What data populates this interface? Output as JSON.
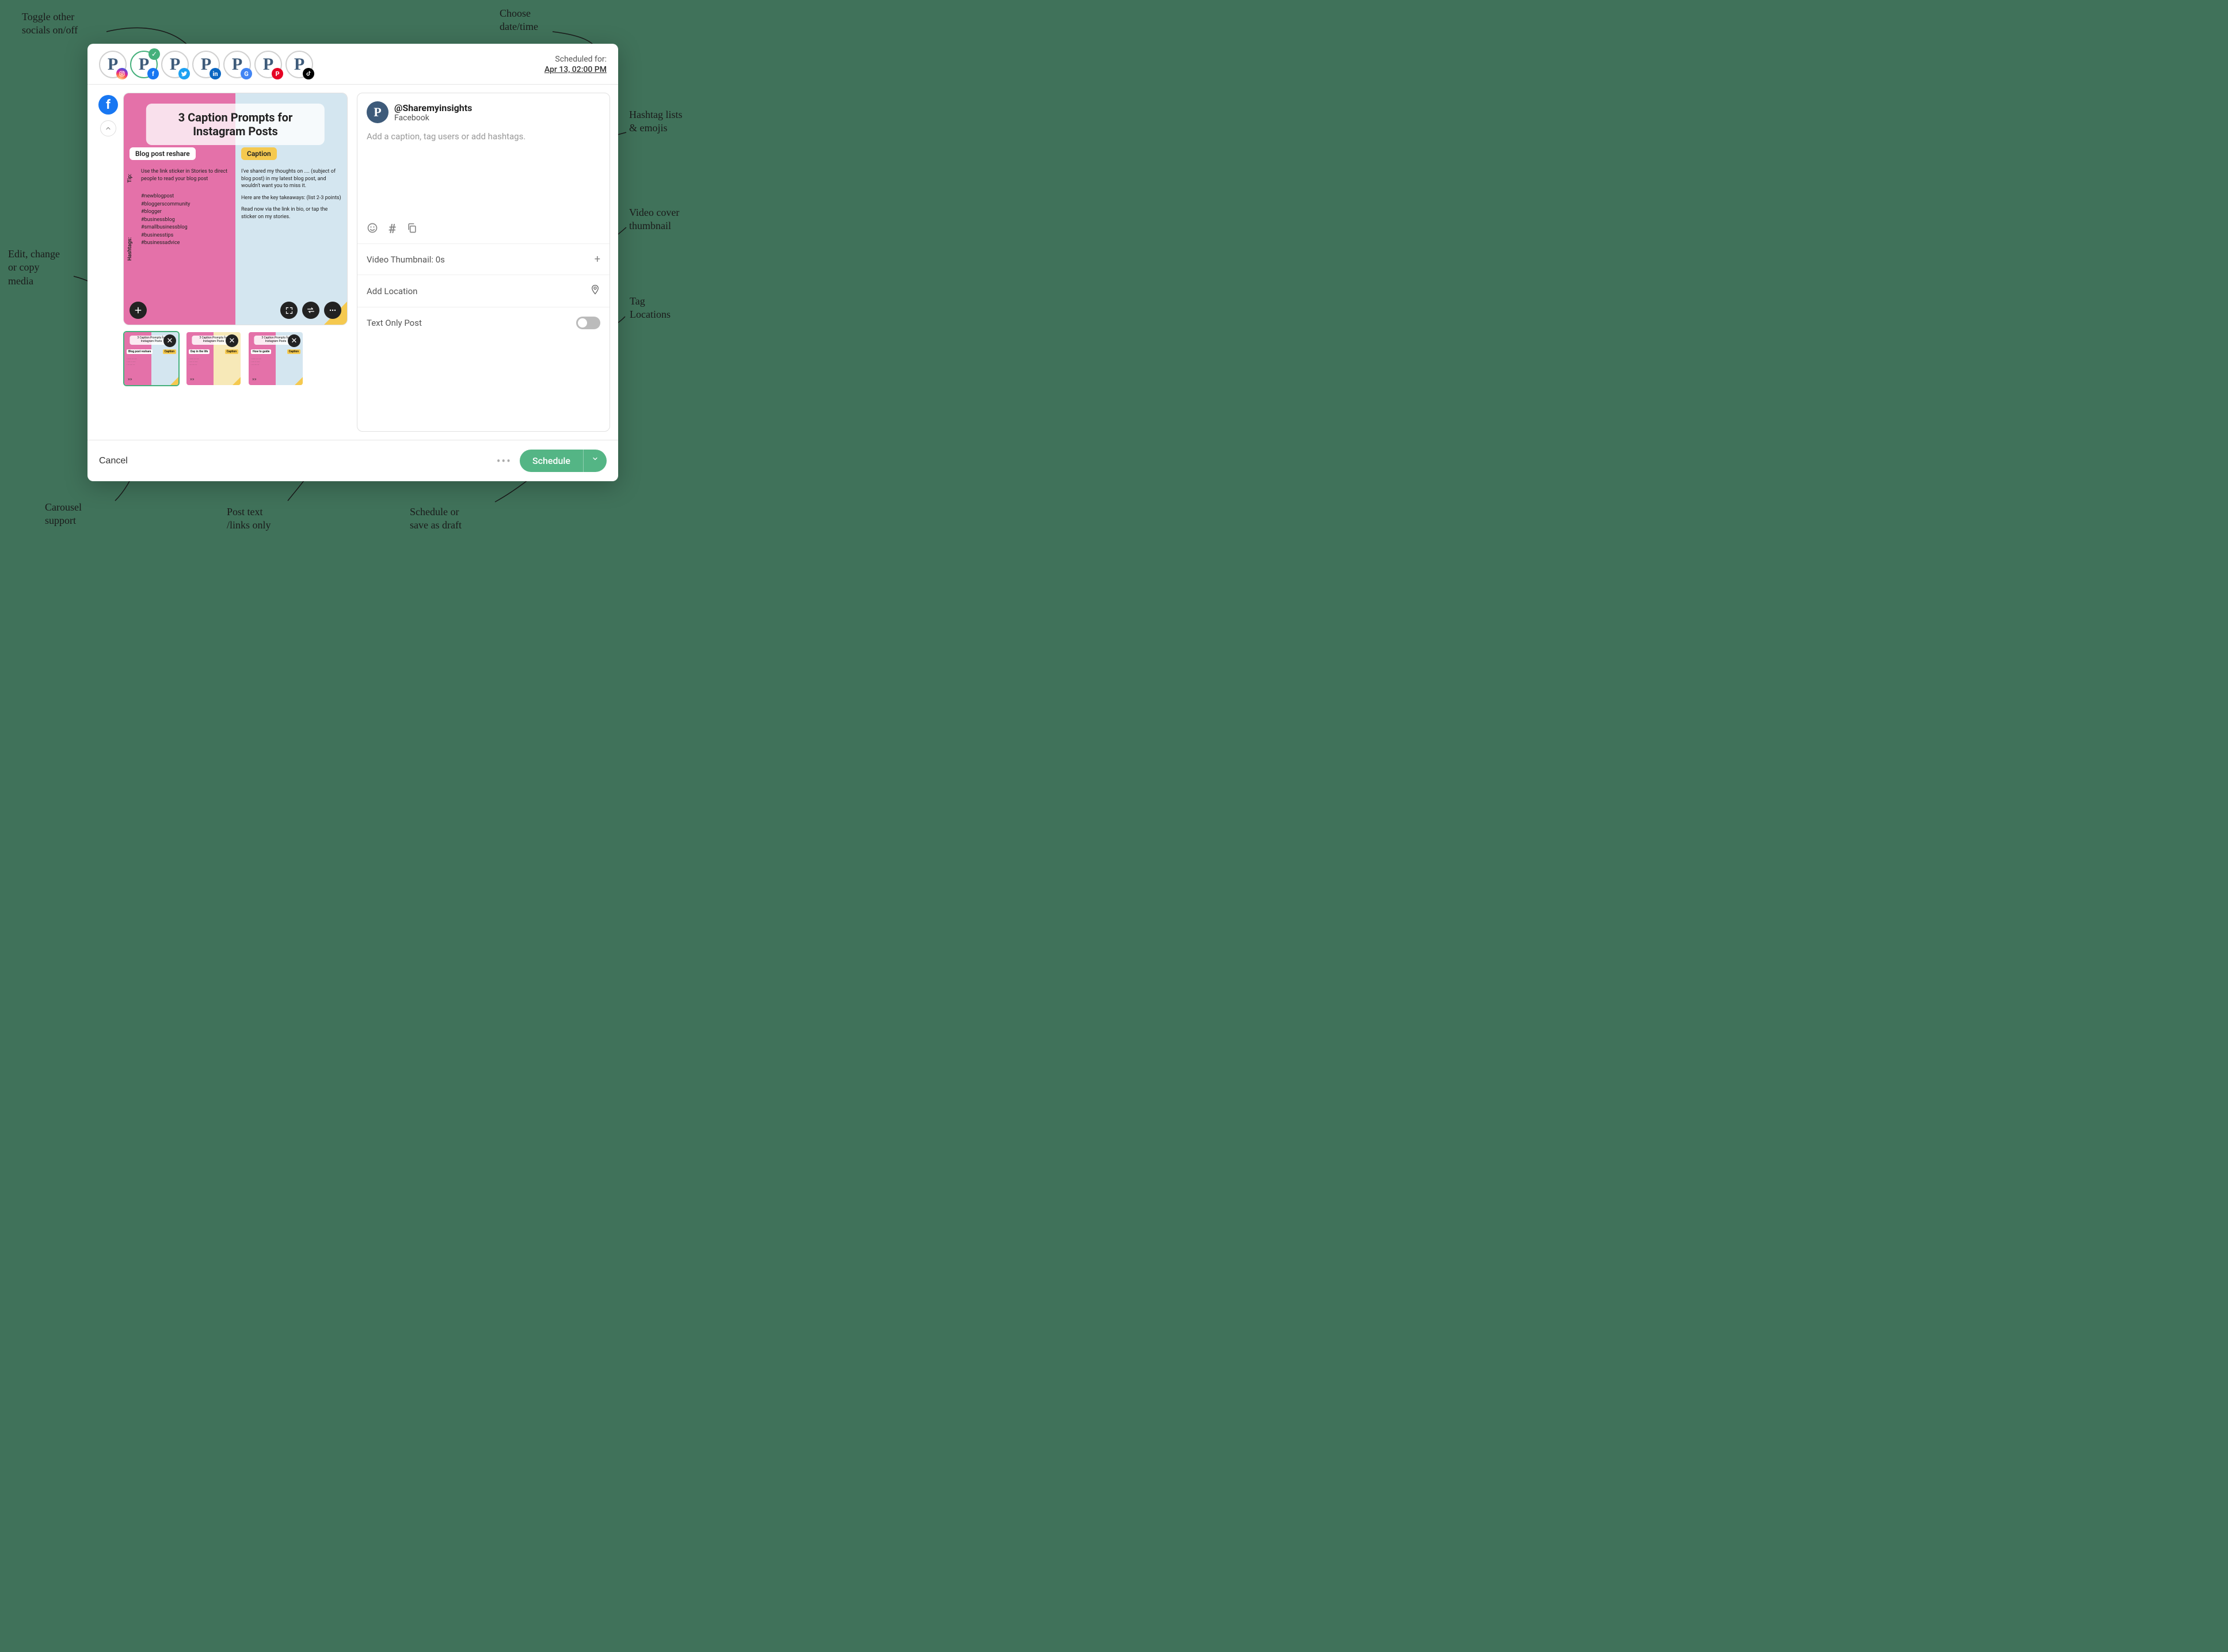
{
  "annotations": {
    "toggle_socials": "Toggle other\nsocials on/off",
    "choose_datetime": "Choose\ndate/time",
    "hashtag_emojis": "Hashtag lists\n& emojis",
    "video_cover": "Video cover\nthumbnail",
    "tag_locations": "Tag\nLocations",
    "edit_media": "Edit, change\nor copy\nmedia",
    "carousel": "Carousel\nsupport",
    "text_only": "Post text\n/links only",
    "schedule_draft": "Schedule or\nsave as draft"
  },
  "header": {
    "scheduled_label": "Scheduled for:",
    "scheduled_datetime": "Apr 13, 02:00 PM",
    "socials": [
      "instagram",
      "facebook",
      "twitter",
      "linkedin",
      "google",
      "pinterest",
      "tiktok"
    ],
    "active_social": "facebook"
  },
  "account": {
    "handle": "@Sharemyinsights",
    "platform": "Facebook"
  },
  "caption": {
    "placeholder": "Add a caption, tag users or add hashtags."
  },
  "rows": {
    "thumbnail": "Video Thumbnail: 0s",
    "location": "Add Location",
    "text_only": "Text Only Post"
  },
  "footer": {
    "cancel": "Cancel",
    "schedule": "Schedule"
  },
  "preview": {
    "title": "3 Caption Prompts for Instagram Posts",
    "pill_left": "Blog post reshare",
    "pill_right": "Caption",
    "tip_label": "Tip:",
    "hashtags_label": "Hashtags:",
    "tip_text": "Use the link sticker in Stories to direct people to read your blog post",
    "hashtags": "#newblogpost\n#bloggerscommunity\n#blogger\n#businessblog\n#smallbusinessblog\n#businesstips\n#businessadvice",
    "right_p1": "I've shared my thoughts on .... (subject of blog post) in my latest blog post, and wouldn't want you to miss it.",
    "right_p2": "Here are the key takeaways: (list 2-3 points)",
    "right_p3": "Read now via the link in bio, or tap the sticker on my stories."
  },
  "thumbs": [
    {
      "title": "3 Caption Prompts for Instagram Posts",
      "pill_l": "Blog post reshare",
      "pill_r": "Caption",
      "alt": false,
      "selected": true
    },
    {
      "title": "3 Caption Prompts for Instagram Posts",
      "pill_l": "Day in the life",
      "pill_r": "Caption",
      "alt": true,
      "selected": false
    },
    {
      "title": "3 Caption Prompts for Instagram Posts",
      "pill_l": "How to guide",
      "pill_r": "Caption",
      "alt": false,
      "selected": false
    }
  ]
}
